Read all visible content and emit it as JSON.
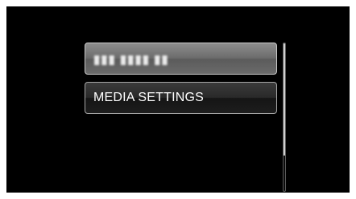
{
  "menu": {
    "items": [
      {
        "label": "▮▮▮ ▮▮▮▮ ▮▮",
        "state": "obscured"
      },
      {
        "label": "MEDIA SETTINGS",
        "state": "selected"
      }
    ]
  },
  "scrollbar": {
    "position_fraction": 0.0,
    "visible_fraction": 0.76
  }
}
